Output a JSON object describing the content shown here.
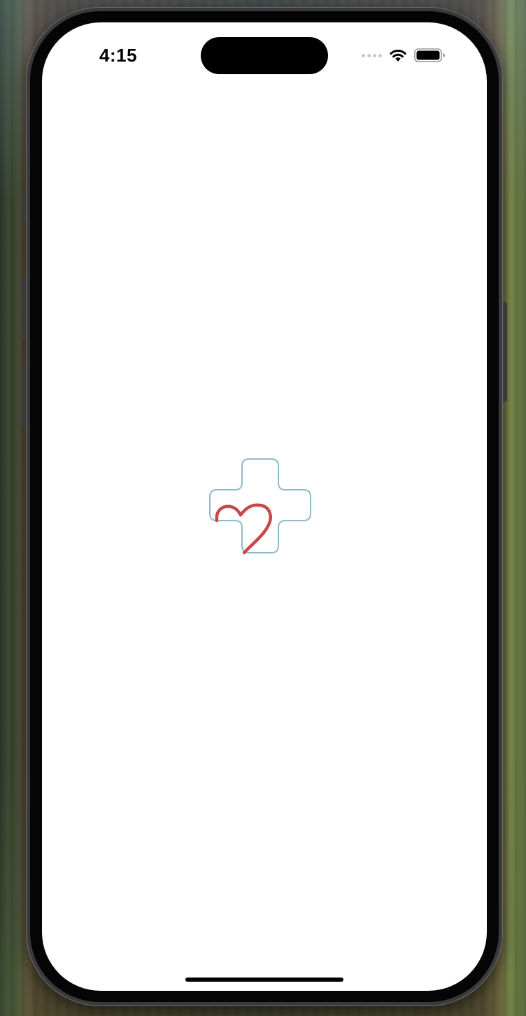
{
  "status_bar": {
    "time": "4:15",
    "signal_icon": "cellular-signal-icon",
    "wifi_icon": "wifi-icon",
    "battery_icon": "battery-icon"
  },
  "splash": {
    "logo_icon": "medical-cross-heart-logo-icon",
    "cross_color": "#8fbccd",
    "heart_color": "#c84848"
  },
  "colors": {
    "screen_background": "#ffffff",
    "device_frame": "#3a3a3c"
  }
}
